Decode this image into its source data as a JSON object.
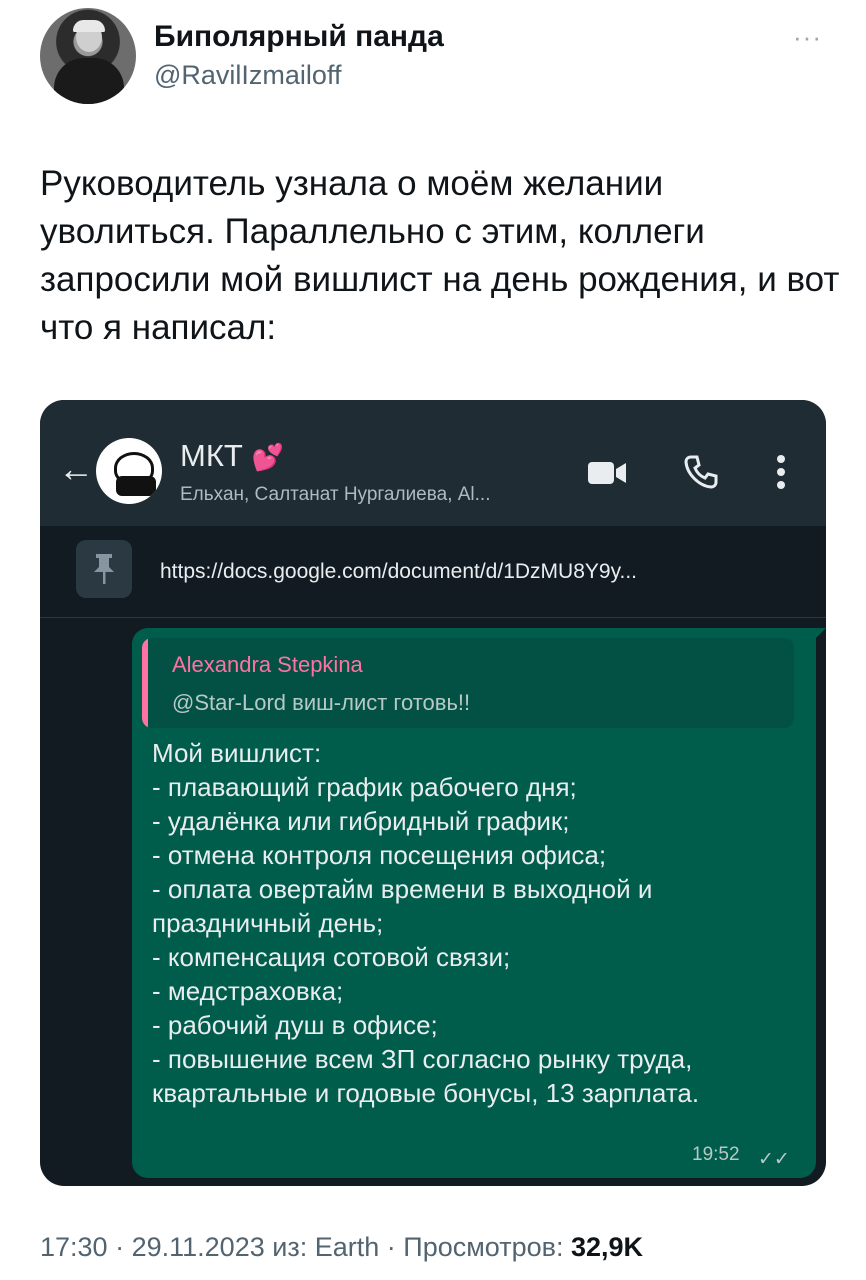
{
  "tweet": {
    "display_name": "Биполярный панда",
    "handle": "@RavilIzmailoff",
    "more_icon": "ellipsis-icon",
    "text": "Руководитель узнала о моём желании уволиться. Параллельно с этим, коллеги запросили мой вишлист на день рождения, и вот что я написал:",
    "time": "17:30",
    "date": "29.11.2023",
    "source_prefix": "из:",
    "source": "Earth",
    "views_label": "Просмотров:",
    "views_count": "32,9K"
  },
  "chat": {
    "title": "МКТ",
    "title_emoji": "💕",
    "subtitle": "Ельхан, Салтанат Нургалиева, Al...",
    "pinned_link": "https://docs.google.com/document/d/1DzMU8Y9y...",
    "quote_author": "Alexandra Stepkina",
    "quote_text": "@Star-Lord виш-лист готовь!!",
    "message": "Мой вишлист:\n- плавающий график рабочего дня;\n- удалёнка или гибридный график;\n- отмена контроля посещения офиса;\n- оплата овертайм времени в выходной и праздничный день;\n- компенсация сотовой связи;\n- медстраховка;\n- рабочий душ в офисе;\n- повышение всем ЗП согласно рынку труда, квартальные и годовые бонусы, 13 зарплата.",
    "message_time": "19:52",
    "colors": {
      "header_bg": "#1f2c34",
      "chat_bg": "#121b22",
      "bubble_bg": "#005c4b",
      "quote_accent": "#ff72a1"
    }
  }
}
